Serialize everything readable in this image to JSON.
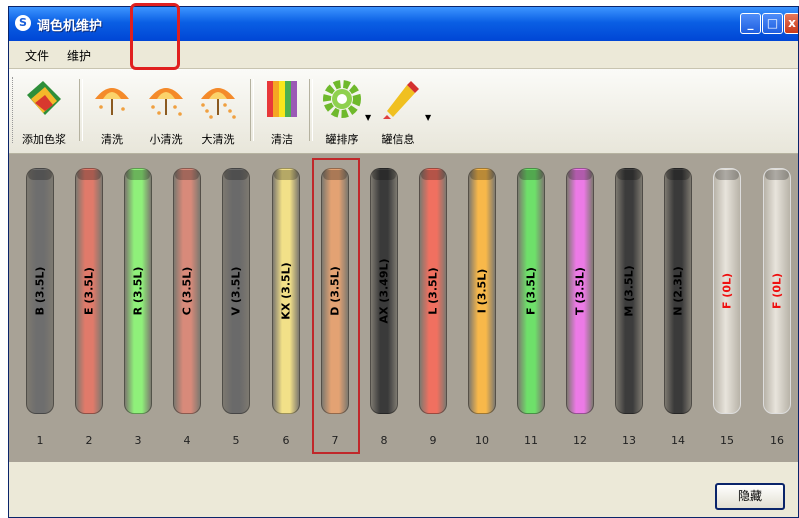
{
  "window": {
    "title": "调色机维护",
    "icon": "app-logo-icon"
  },
  "title_buttons": [
    "minimize-icon",
    "maximize-icon",
    "close-icon"
  ],
  "menu": [
    "文件",
    "维护"
  ],
  "toolbar": {
    "add_paste": "添加色浆",
    "clean": "清洗",
    "small_clean": "小清洗",
    "big_clean": "大清洗",
    "wipe": "清洁",
    "sort": "罐排序",
    "info": "罐信息"
  },
  "selected_tube": 7,
  "tubes": [
    {
      "num": "1",
      "label": "B (3.5L)",
      "color": "#6e6e6e",
      "empty": false
    },
    {
      "num": "2",
      "label": "E (3.5L)",
      "color": "#e07a6a",
      "empty": false
    },
    {
      "num": "3",
      "label": "R (3.5L)",
      "color": "#8ff07a",
      "empty": false
    },
    {
      "num": "4",
      "label": "C (3.5L)",
      "color": "#d88a7a",
      "empty": false
    },
    {
      "num": "5",
      "label": "V (3.5L)",
      "color": "#6a6a6a",
      "empty": false
    },
    {
      "num": "6",
      "label": "KX (3.5L)",
      "color": "#f2e088",
      "empty": false
    },
    {
      "num": "7",
      "label": "D (3.5L)",
      "color": "#e3a273",
      "empty": false
    },
    {
      "num": "8",
      "label": "AX (3.49L)",
      "color": "#3a3a3a",
      "empty": false
    },
    {
      "num": "9",
      "label": "L (3.5L)",
      "color": "#f07060",
      "empty": false
    },
    {
      "num": "10",
      "label": "I (3.5L)",
      "color": "#f8b84a",
      "empty": false
    },
    {
      "num": "11",
      "label": "F (3.5L)",
      "color": "#6ee06a",
      "empty": false
    },
    {
      "num": "12",
      "label": "T (3.5L)",
      "color": "#ec7ae6",
      "empty": false
    },
    {
      "num": "13",
      "label": "M (3.5L)",
      "color": "#3c3c3c",
      "empty": false
    },
    {
      "num": "14",
      "label": "N (2.3L)",
      "color": "#3a3a3a",
      "empty": false
    },
    {
      "num": "15",
      "label": "F (0L)",
      "color": "#cfcac0",
      "empty": true
    },
    {
      "num": "16",
      "label": "F (0L)",
      "color": "#cfcac0",
      "empty": true
    }
  ],
  "buttons": {
    "hide": "隐藏"
  }
}
